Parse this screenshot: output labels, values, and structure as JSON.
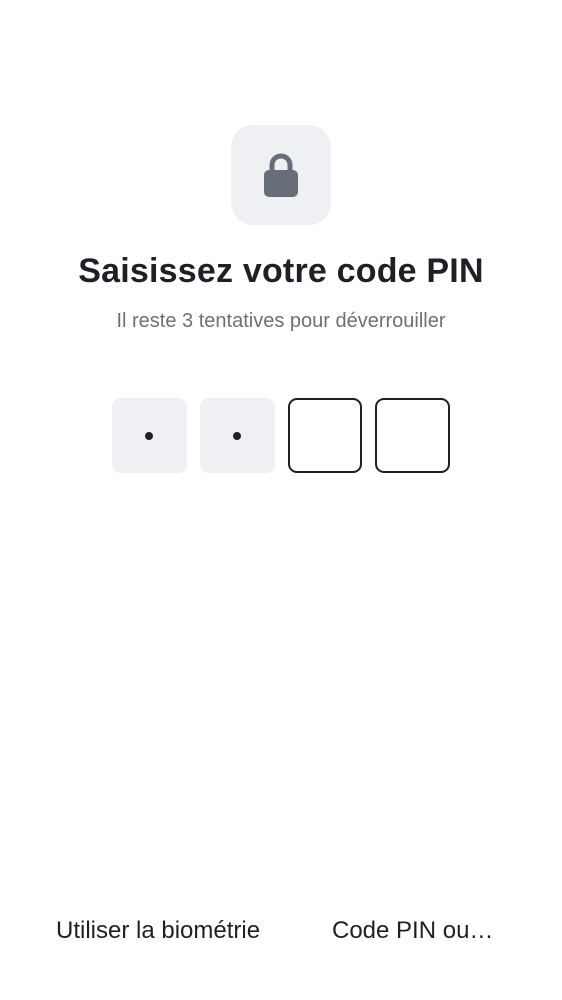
{
  "icons": {
    "lock": "lock-icon"
  },
  "header": {
    "title": "Saisissez votre code PIN",
    "subtitle": "Il reste 3 tentatives pour déverrouiller"
  },
  "pin": {
    "length": 4,
    "entered": 2
  },
  "actions": {
    "biometric_label": "Utiliser la biométrie",
    "alt_label": "Code PIN ou…"
  },
  "colors": {
    "text": "#1f2025",
    "muted": "#6b7079",
    "tile": "#eff0f4",
    "icon": "#676e78"
  }
}
